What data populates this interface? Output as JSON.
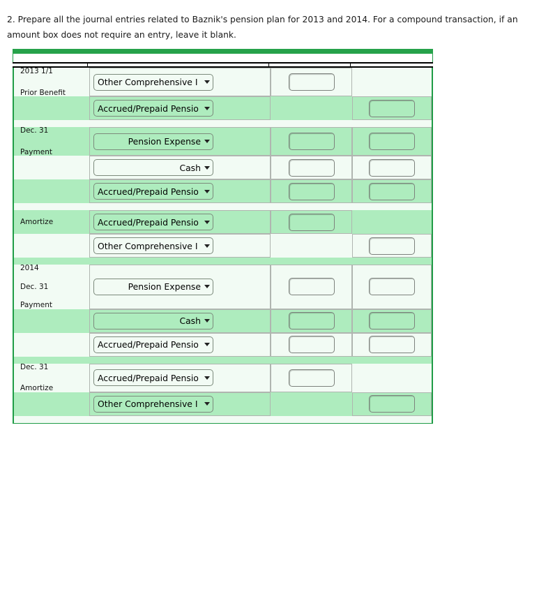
{
  "instruction": "2. Prepare all the journal entries related to Baznik's pension plan for 2013 and 2014. For a compound transaction, if an amount box does not require an entry, leave it blank.",
  "colors": {
    "header_bar": "#26a24a",
    "row_mint": "#aeecbe",
    "row_pale": "#f2fbf4",
    "frame_border": "#1f9c46"
  },
  "accounts": {
    "oci": "Other Comprehensive I",
    "accrued": "Accrued/Prepaid Pensio",
    "pension_expense": "Pension Expense",
    "cash": "Cash"
  },
  "amount_placeholder": "",
  "rows": [
    {
      "id": "r1",
      "shade": "pale",
      "date_lines": [
        "2013 1/1",
        "Prior Benefit"
      ],
      "account": "Other Comprehensive I",
      "account_align": "left",
      "debit": {
        "present": true,
        "value": ""
      },
      "credit": {
        "present": false,
        "value": ""
      }
    },
    {
      "id": "r2",
      "shade": "mint",
      "date_lines": [],
      "account": "Accrued/Prepaid Pensio",
      "account_align": "left",
      "debit": {
        "present": false,
        "value": ""
      },
      "credit": {
        "present": true,
        "value": ""
      }
    },
    {
      "id": "r3",
      "shade": "pale",
      "spacer": true,
      "date_lines": [],
      "account": null,
      "debit": {
        "present": false,
        "value": ""
      },
      "credit": {
        "present": false,
        "value": ""
      }
    },
    {
      "id": "r4",
      "shade": "mint",
      "date_lines": [
        "Dec. 31",
        "Payment"
      ],
      "account": "Pension Expense",
      "account_align": "right",
      "debit": {
        "present": true,
        "value": ""
      },
      "credit": {
        "present": true,
        "value": ""
      }
    },
    {
      "id": "r5",
      "shade": "pale",
      "date_lines": [],
      "account": "Cash",
      "account_align": "right",
      "debit": {
        "present": true,
        "value": ""
      },
      "credit": {
        "present": true,
        "value": ""
      }
    },
    {
      "id": "r6",
      "shade": "mint",
      "date_lines": [],
      "account": "Accrued/Prepaid Pensio",
      "account_align": "left",
      "debit": {
        "present": true,
        "value": ""
      },
      "credit": {
        "present": true,
        "value": ""
      }
    },
    {
      "id": "r7",
      "shade": "pale",
      "spacer": true,
      "date_lines": [],
      "account": null,
      "debit": {
        "present": false,
        "value": ""
      },
      "credit": {
        "present": false,
        "value": ""
      }
    },
    {
      "id": "r8",
      "shade": "mint",
      "date_lines": [
        "Amortize"
      ],
      "account": "Accrued/Prepaid Pensio",
      "account_align": "left",
      "debit": {
        "present": true,
        "value": ""
      },
      "credit": {
        "present": false,
        "value": ""
      }
    },
    {
      "id": "r9",
      "shade": "pale",
      "date_lines": [],
      "account": "Other Comprehensive I",
      "account_align": "left",
      "debit": {
        "present": false,
        "value": ""
      },
      "credit": {
        "present": true,
        "value": ""
      }
    },
    {
      "id": "r10",
      "shade": "mint",
      "spacer": true,
      "date_lines": [],
      "account": null,
      "debit": {
        "present": false,
        "value": ""
      },
      "credit": {
        "present": false,
        "value": ""
      }
    },
    {
      "id": "r11",
      "shade": "pale",
      "date_lines": [
        "2014",
        "Dec. 31",
        "Payment"
      ],
      "account": "Pension Expense",
      "account_align": "right",
      "debit": {
        "present": true,
        "value": ""
      },
      "credit": {
        "present": true,
        "value": ""
      }
    },
    {
      "id": "r12",
      "shade": "mint",
      "date_lines": [],
      "account": "Cash",
      "account_align": "right",
      "debit": {
        "present": true,
        "value": ""
      },
      "credit": {
        "present": true,
        "value": ""
      }
    },
    {
      "id": "r13",
      "shade": "pale",
      "date_lines": [],
      "account": "Accrued/Prepaid Pensio",
      "account_align": "left",
      "debit": {
        "present": true,
        "value": ""
      },
      "credit": {
        "present": true,
        "value": ""
      }
    },
    {
      "id": "r14",
      "shade": "mint",
      "spacer": true,
      "date_lines": [],
      "account": null,
      "debit": {
        "present": false,
        "value": ""
      },
      "credit": {
        "present": false,
        "value": ""
      }
    },
    {
      "id": "r15",
      "shade": "pale",
      "date_lines": [
        "Dec. 31",
        "Amortize"
      ],
      "account": "Accrued/Prepaid Pensio",
      "account_align": "left",
      "debit": {
        "present": true,
        "value": ""
      },
      "credit": {
        "present": false,
        "value": ""
      }
    },
    {
      "id": "r16",
      "shade": "mint",
      "date_lines": [],
      "account": "Other Comprehensive I",
      "account_align": "left",
      "debit": {
        "present": false,
        "value": ""
      },
      "credit": {
        "present": true,
        "value": ""
      }
    },
    {
      "id": "r17",
      "shade": "pale",
      "spacer": true,
      "date_lines": [],
      "account": null,
      "debit": {
        "present": false,
        "value": ""
      },
      "credit": {
        "present": false,
        "value": ""
      }
    }
  ]
}
